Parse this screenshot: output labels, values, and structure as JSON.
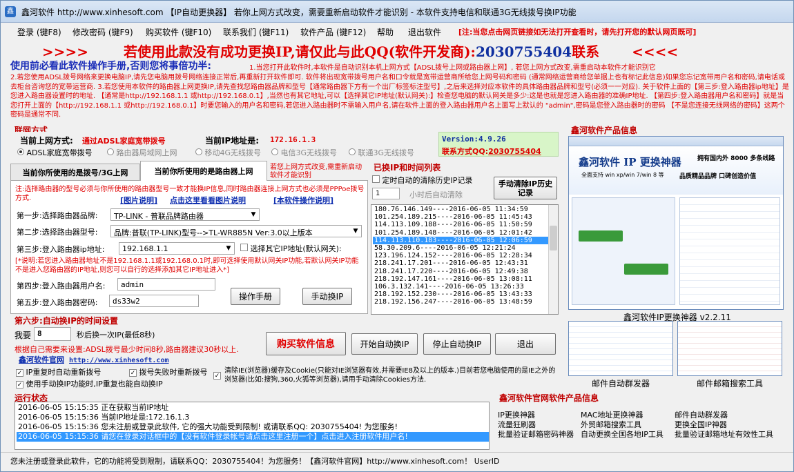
{
  "window": {
    "title": "鑫河软件 http://www.xinhesoft.com 【IP自动更换器】 若你上网方式改变，需要重新启动软件才能识别 - 本软件支持电信和联通3G无线拨号换IP功能"
  },
  "menu": {
    "items": [
      "登录 (键F8)",
      "修改密码 (键F9)",
      "购买软件 (键F10)",
      "联系我们 (键F11)",
      "软件产品 (键F12)",
      "帮助",
      "退出软件"
    ],
    "warning": "[注:当您点击网页链接如无法打开查看时，请先打开您的默认网页既可]"
  },
  "banner": {
    "arrows_left": ">>>>",
    "text": "若使用此款没有成功更换IP,请仅此与此QQ(软件开发商):",
    "qq": "2030755404",
    "suffix": "联系",
    "arrows_right": "<<<<"
  },
  "notice": {
    "title": "使用前必看此软件操作手册,否则您将事倍功半:",
    "inline": "1.当您打开此软件时,本软件是自动识别本机上网方式【ADSL拨号上网或路由器上网】,  若您上网方式改变,需重启动本软件才能识别它",
    "body": "2.若您使用ADSL拨号网络来更换电脑IP,请先您电脑用拨号网络连接正常后,再重新打开软件即可. 软件将出现宽带拨号用户名和口令就是宽带运营商所给您上网号码和密码 (通常网络运营商给您单据上也有标记此信息)如果您忘记宽带用户名和密码,请电话或去柜台咨询您的宽带运营商. 3.若您使用本软件的路由器上网更换IP,请先查找您路由器品牌和型号【通常路由器下方有一个出厂标签标注型号】,之后来选择对应本软件的具体路由器品牌和型号(必须一一对应). 关于软件上面的【第三步:登入路由器ip地址】是您进入路由器设置时的地址. 【通常是http://192.168.1.1 或http://192.168.0.1】,当然也有其它地址,可以【选择其它IP地址(默认网关):】检查您电脑的默认网关是多少:这是也就是您进入路由器的准确IP地址. 【第四步:登入路由器用户名和密码】就是当您打开上面的【http://192.168.1.1 或http://192.168.0.1】时要您输入的用户名和密码,若您进入路由器时不需输入用户名,请在软件上面的登入路由器用户名上面写上默认的 \"admin\",密码是您登入路由器时的密码 【不是您连接无线网络的密码】这两个密码是通常不同."
  },
  "connection": {
    "section_title": "联网方式",
    "current_label": "当前上网方式:",
    "current_value": "通过ADSL家庭宽带拨号",
    "ip_label": "当前IP地址是:",
    "ip_value": "172.16.1.3",
    "options": [
      "ADSL家庭宽带拨号",
      "路由器局域网上网",
      "移动4G无线拨号",
      "电信3G无线拨号",
      "联通3G无线拨号"
    ],
    "version": "Version:4.9.26",
    "contact_label": "联系方式QQ:",
    "contact_qq": "2030755404"
  },
  "tabs": {
    "tab1": "当前你所使用的是拨号/3G上网",
    "tab2": "当前你所使用的是路由器上网",
    "note": "若您上网方式改变,需重新启动软件才能识别"
  },
  "router": {
    "note": "注:选择路由器的型号必须与你所使用的路由器型号一致才能换IP信息,同时路由器连接上网方式也必须是PPPoe拨号方式.",
    "link1": "[图片说明]",
    "link2": "点击这里看看图片说明",
    "link3": "[本软件操作说明]",
    "step1_label": "第一步:选择路由器品牌:",
    "step1_value": "TP-LINK - 普联品牌路由器",
    "step2_label": "第二步:选择路由器型号:",
    "step2_value": "品牌:普联(TP-LINK)型号-->TL-WR885N Ver:3.0以上版本",
    "step3_label": "第三步:登入路由器ip地址:",
    "step3_value": "192.168.1.1",
    "step3_check": "选择其它IP地址(默认网关):",
    "warn": "[*说明:若您进入路由器地址不是192.168.1.1或192.168.0.1时,即可选择使用默认网关IP功能,若默认网关IP功能不是进入您路由器的IP地址,则您可以自行的选择添加其它IP地址进入*]",
    "step4_label": "第四步:登入路由器用户名:",
    "step4_value": "admin",
    "step5_label": "第五步:登入路由器密码:",
    "step5_value": "ds33w2",
    "manual_button": "操作手册",
    "manual_switch_button": "手动换IP"
  },
  "history": {
    "section_title": "已换IP和时间列表",
    "check_label": "定时自动的清除历史IP记录",
    "hours_value": "1",
    "hours_label": "小时后自动清除",
    "clear_button": "手动清除IP历史记录",
    "rows": [
      "180.76.146.149----2016-06-05 11:34:59",
      "101.254.189.215----2016-06-05 11:45:43",
      "114.113.109.188----2016-06-05 11:50:59",
      "101.254.189.148----2016-06-05 12:01:42",
      "114.113.110.183----2016-06-05 12:06:59",
      "58.30.209.6----2016-06-05 12:21:24",
      "123.196.124.152----2016-06-05 12:28:34",
      "218.241.17.201----2016-06-05 12:43:31",
      "218.241.17.220----2016-06-05 12:49:38",
      "218.192.147.161----2016-06-05 13:08:11",
      "106.3.132.141----2016-06-05 13:26:33",
      "218.192.152.230----2016-06-05 13:43:33",
      "218.192.156.247----2016-06-05 13:48:59"
    ],
    "selected_index": 4
  },
  "auto": {
    "section_title": "第六步:自动换IP的时间设置",
    "label": "我要",
    "value": "8",
    "suffix": "秒后换一次IP(最低8秒)",
    "hint": "根据自己需要来设置:ADSL拨号最少时间8秒,路由器建议30秒以上.",
    "site_label": "鑫河软件官网",
    "site_url": "http://www.xinhesoft.com",
    "buy_button": "购买软件信息",
    "start_button": "开始自动换IP",
    "stop_button": "停止自动换IP",
    "exit_button": "退出",
    "opt1": "IP重复时自动重新拨号",
    "opt2": "拨号失败时重新拨号",
    "opt3": "使用手动换IP功能时,IP重复也能自动换IP",
    "opt4": "清除IE(浏览器)缓存及Cookie(只能对IE浏览器有效,并需要IE8及以上的版本.)目前若您电脑使用的是IE之外的浏览器(比如:搜狗,360,火狐等浏览器),请用手动清除Cookies方法."
  },
  "products": {
    "section_title": "鑫河软件产品信息",
    "main_caption": "鑫河软件IP更换神器 v2.2.11",
    "thumb1_caption": "邮件自动群发器",
    "thumb2_caption": "邮件邮箱搜索工具",
    "shot_title": "鑫河软件 IP 更换神器",
    "shot_sub1": "拥有国内外 8000 多条线路",
    "shot_sub2": "全面支持 win xp/win 7/win 8 等",
    "shot_sub3": "品质精品品牌  口碑创造价值"
  },
  "status": {
    "section_title": "运行状态",
    "rows": [
      "2016-06-05 15:15:35 正在获取当前IP地址",
      "2016-06-05 15:15:36 当前IP地址是:172.16.1.3",
      "2016-06-05 15:15:36 您未注册或登录此软件, 它的强大功能受到限制! 或请联系QQ: 2030755404! 为您服务!",
      "2016-06-05 15:15:36 请您在登录对话框中的【没有软件登录帐号请点击这里注册一个】点击进入注册软件用户名!"
    ],
    "selected_index": 3
  },
  "official": {
    "section_title": "鑫河软件官网软件产品信息",
    "items": [
      "IP更换神器",
      "MAC地址更换神器",
      "邮件自动群发器",
      "流量狂刷器",
      "外贸邮箱搜索工具",
      "更换全国IP神器",
      "批量验证邮箱密码神器",
      "自动更换全国各地IP工具",
      "批量验证邮箱地址有效性工具"
    ]
  },
  "statusbar": {
    "text": "您未注册或登录此软件，它的功能将受到限制，请联系QQ：2030755404！为您服务！【鑫河软件官网】http://www.xinhesoft.com！   UserID"
  }
}
